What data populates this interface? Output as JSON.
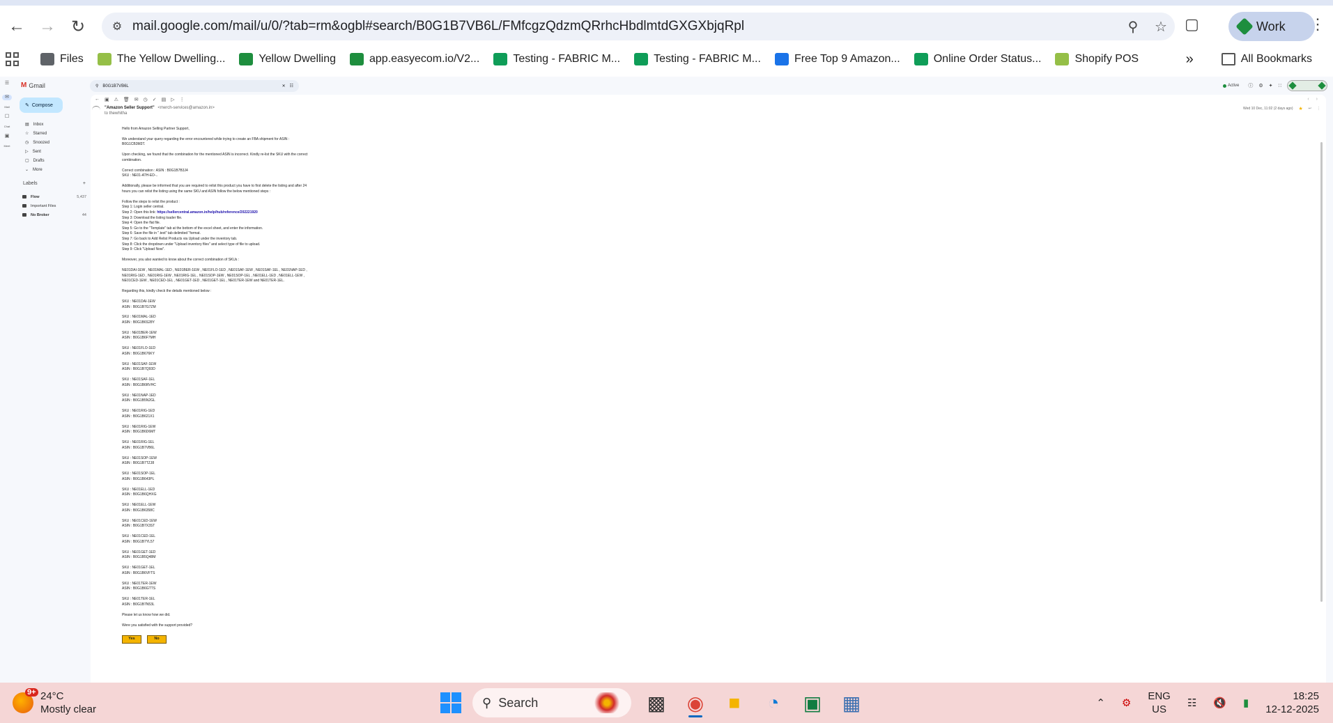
{
  "browser": {
    "url": "mail.google.com/mail/u/0/?tab=rm&ogbl#search/B0G1B7VB6L/FMfcgzQdzmQRrhcHbdlmtdGXGXbjqRpl",
    "profile_label": "Work",
    "bookmarks": [
      {
        "label": "Files",
        "color": "#5f6368"
      },
      {
        "label": "The Yellow Dwelling...",
        "color": "#95bf47"
      },
      {
        "label": "Yellow Dwelling",
        "color": "#1e8e3e"
      },
      {
        "label": "app.easyecom.io/V2...",
        "color": "#1e8e3e"
      },
      {
        "label": "Testing - FABRIC M...",
        "color": "#0f9d58"
      },
      {
        "label": "Testing - FABRIC M...",
        "color": "#0f9d58"
      },
      {
        "label": "Free Top 9 Amazon...",
        "color": "#1a73e8"
      },
      {
        "label": "Online Order Status...",
        "color": "#0f9d58"
      },
      {
        "label": "Shopify POS",
        "color": "#95bf47"
      }
    ],
    "all_bookmarks_label": "All Bookmarks"
  },
  "gmail": {
    "logo_text": "Gmail",
    "rail": [
      "Mail",
      "Chat",
      "Meet"
    ],
    "compose_label": "Compose",
    "nav_items": [
      "Inbox",
      "Starred",
      "Snoozed",
      "Sent",
      "Drafts",
      "More"
    ],
    "labels_heading": "Labels",
    "labels": [
      {
        "name": "Flow",
        "count": "5,437"
      },
      {
        "name": "Important Files",
        "count": ""
      },
      {
        "name": "No Broker",
        "count": "44"
      }
    ],
    "search_query": "B0G1B7VB6L",
    "status": "Active",
    "sender_name": "\"Amazon Seller Support\"",
    "sender_email": "<merch-services@amazon.in>",
    "to_line": "to thewhitha",
    "date": "Wed 10 Dec, 11:02 (2 days ago)",
    "body_paragraphs": [
      "Hello from Amazon Selling Partner Support,",
      "We understand your query regarding the error encountered while trying to create an FBA shipment for ASIN : B0G1CB3M3T.",
      "Upon checking, we found that the combination for the mentioned ASIN is incorrect. Kindly re-list the SKU with the correct combination.",
      "Correct combination : ASIN : B0G1B7B3J4\nSKU : NE01-ATH-ED-..",
      "Additionally, please be informed that you are required to relist this product you have to first delete the listing and after 24 hours you can relist the listing using the same SKU and ASIN follow the below mentioned steps :"
    ],
    "steps_intro": "Follow the steps to relist the product :",
    "steps": [
      "Step 1: Login seller central.",
      "Step 2: Open this link:",
      "Step 3: Download the listing loader file.",
      "Step 4: Open the flat file.",
      "Step 5: Go to the \"Template\" tab at the bottom of the excel sheet, and enter the information.",
      "Step 6: Save the file in \".text\" tab delimited \"format.",
      "Step 7: Go back to Add Relist Products via Upload under the inventory tab.",
      "Step 8: Click the dropdown under \"Upload inventory files\" and select type of file to upload.",
      "Step 9: Click \"Upload Now\"."
    ],
    "step_link": "https://sellercentral.amazon.in/help/hub/reference/202221920",
    "sku_intro": "Moreover, you also wanted to know about the correct combination of SKUs :",
    "sku_list": "NE01DAI-1EW , NE01MAL-1ED , NE01BER-1EW , NE01FLO-1ED , NE01SAF-1EW , NE01SAF-1EL , NE01NAP-1ED , NE01RIG-1ED , NE01RIG-1EW , NE01RIG-1EL , NE01SOP-1EW , NE01SOP-1EL , NE01ELL-1ED , NE01ELL-1EW , NE01CED-1EW , NE01CED-1EL , NE01GET-1ED , NE01GET-1EL , NE01TER-1EW and NE01TER-1EL.",
    "details_intro": "Regarding this, kindly check the details mentioned below :",
    "pairs": [
      {
        "sku": "SKU : NE01DAI-1EW",
        "asin": "ASIN : B0G1B7G7ZM"
      },
      {
        "sku": "SKU : NE01MAL-1ED",
        "asin": "ASIN : B0G1B6S28Y"
      },
      {
        "sku": "SKU : NE01BER-1EW",
        "asin": "ASIN : B0G1B6F7MH"
      },
      {
        "sku": "SKU : NE01FLO-1ED",
        "asin": "ASIN : B0G1B676KY"
      },
      {
        "sku": "SKU : NE01SAF-1EW",
        "asin": "ASIN : B0G1B7Q93D"
      },
      {
        "sku": "SKU : NE01SAF-1EL",
        "asin": "ASIN : B0G1B6RVHC"
      },
      {
        "sku": "SKU : NE01NAP-1ED",
        "asin": "ASIN : B0G1B5N2GL"
      },
      {
        "sku": "SKU : NE01RIG-1ED",
        "asin": "ASIN : B0G1B621X1"
      },
      {
        "sku": "SKU : NE01RIG-1EW",
        "asin": "ASIN : B0G1B6D6MT"
      },
      {
        "sku": "SKU : NE01RIG-1EL",
        "asin": "ASIN : B0G1B7VB6L"
      },
      {
        "sku": "SKU : NE01SOP-1EW",
        "asin": "ASIN : B0G1B7TZJ8"
      },
      {
        "sku": "SKU : NE01SOP-1EL",
        "asin": "ASIN : B0G1B643PL"
      },
      {
        "sku": "SKU : NE01ELL-1ED",
        "asin": "ASIN : B0G1B6QHXG"
      },
      {
        "sku": "SKU : NE01ELL-1EW",
        "asin": "ASIN : B0G1B6358C"
      },
      {
        "sku": "SKU : NE01CED-1EW",
        "asin": "ASIN : B0G1B7X3ST"
      },
      {
        "sku": "SKU : NE01CED-1EL",
        "asin": "ASIN : B0G1B7YL57"
      },
      {
        "sku": "SKU : NE01GET-1ED",
        "asin": "ASIN : B0G1B5Q48M"
      },
      {
        "sku": "SKU : NE01GET-1EL",
        "asin": "ASIN : B0G1B6VFTS"
      },
      {
        "sku": "SKU : NE01TER-1EW",
        "asin": "ASIN : B0G1B6GTTS"
      },
      {
        "sku": "SKU : NE01TER-1EL",
        "asin": "ASIN : B0G1B7N53L"
      }
    ],
    "closing": "Please let us know how we did.",
    "survey_question": "Were you satisfied with the support provided?",
    "yes_label": "Yes",
    "no_label": "No"
  },
  "taskbar": {
    "weather_badge": "9+",
    "temperature": "24°C",
    "condition": "Mostly clear",
    "search_label": "Search",
    "lang_1": "ENG",
    "lang_2": "US",
    "time": "18:25",
    "date": "12-12-2025"
  }
}
